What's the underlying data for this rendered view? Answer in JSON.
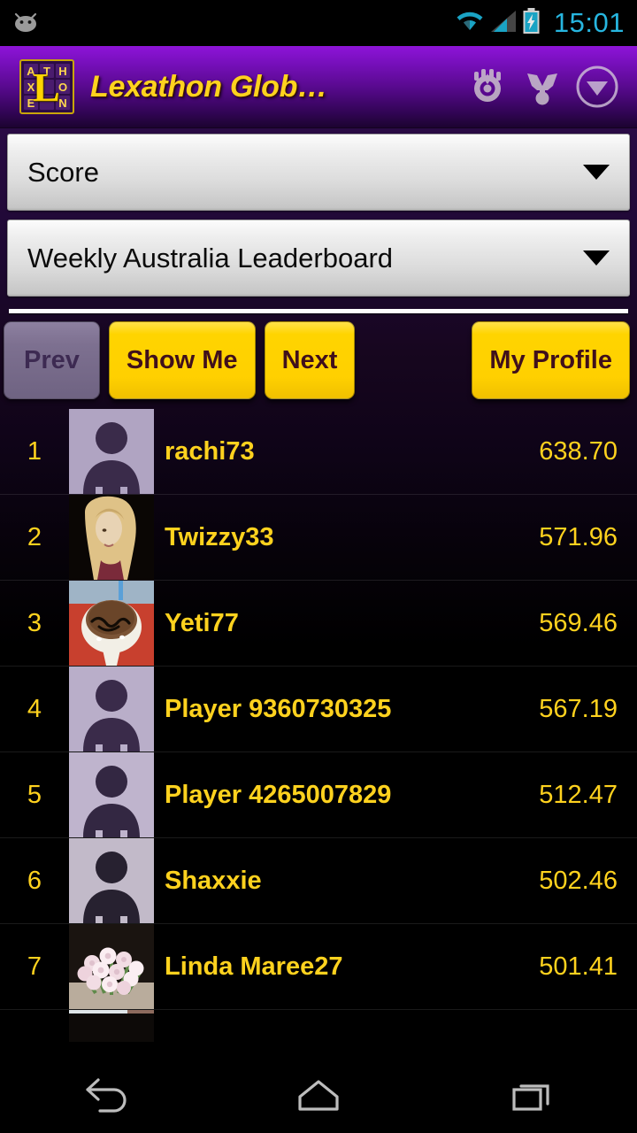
{
  "status_bar": {
    "notification_icon": "android-bean-icon",
    "wifi_icon": "wifi-icon",
    "signal_icon": "cellular-signal-icon",
    "battery_icon": "battery-charging-icon",
    "clock": "15:01",
    "accent_color": "#27b6e0"
  },
  "action_bar": {
    "app_icon": {
      "name": "lexathon-logo-icon",
      "tiles": [
        "A",
        "T",
        "H",
        "X",
        "",
        "O",
        "E",
        "",
        "N"
      ],
      "overlay_letter": "L"
    },
    "title": "Lexathon Glob…",
    "title_color": "#ffd21e",
    "icons": [
      {
        "name": "settings-gear-icon",
        "label": "Settings"
      },
      {
        "name": "trophy-person-icon",
        "label": "Achievements"
      },
      {
        "name": "overflow-chevron-down-icon",
        "label": "More"
      }
    ]
  },
  "filters": {
    "metric": {
      "value": "Score",
      "placeholder": "Score"
    },
    "board": {
      "value": "Weekly Australia Leaderboard",
      "placeholder": "Weekly Australia Leaderboard"
    }
  },
  "toolbar": {
    "prev_label": "Prev",
    "prev_enabled": false,
    "show_me_label": "Show Me",
    "next_label": "Next",
    "my_profile_label": "My Profile",
    "button_color": "#ffd400",
    "disabled_color": "#7d7090"
  },
  "leaderboard": {
    "rows": [
      {
        "rank": "1",
        "name": "rachi73",
        "score": "638.70",
        "avatar": "default"
      },
      {
        "rank": "2",
        "name": "Twizzy33",
        "score": "571.96",
        "avatar": "photo-portrait"
      },
      {
        "rank": "3",
        "name": "Yeti77",
        "score": "569.46",
        "avatar": "photo-cake"
      },
      {
        "rank": "4",
        "name": "Player 9360730325",
        "score": "567.19",
        "avatar": "default"
      },
      {
        "rank": "5",
        "name": "Player 4265007829",
        "score": "512.47",
        "avatar": "default"
      },
      {
        "rank": "6",
        "name": "Shaxxie",
        "score": "502.46",
        "avatar": "default"
      },
      {
        "rank": "7",
        "name": "Linda Maree27",
        "score": "501.41",
        "avatar": "photo-flowers"
      },
      {
        "rank": "",
        "name": "",
        "score": "",
        "avatar": "photo-partial"
      }
    ],
    "text_color": "#ffd21e"
  },
  "nav_bar": {
    "back": "back-icon",
    "home": "home-icon",
    "recents": "recents-icon"
  }
}
